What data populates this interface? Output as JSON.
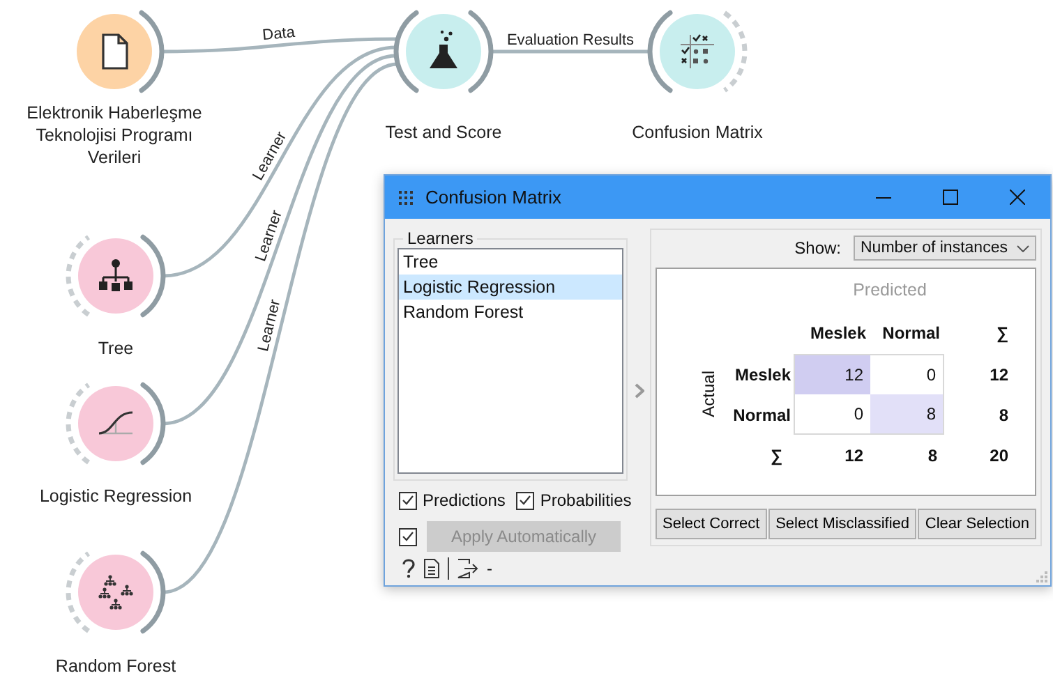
{
  "canvas": {
    "nodes": [
      {
        "kind": "file",
        "label": "Elektronik Haberleşme Teknolojisi Programı Verileri"
      },
      {
        "kind": "test",
        "label": "Test and Score"
      },
      {
        "kind": "confusion",
        "label": "Confusion Matrix"
      },
      {
        "kind": "tree",
        "label": "Tree"
      },
      {
        "kind": "logistic",
        "label": "Logistic Regression"
      },
      {
        "kind": "forest",
        "label": "Random Forest"
      }
    ],
    "links": [
      {
        "label": "Data"
      },
      {
        "label": "Learner"
      },
      {
        "label": "Learner"
      },
      {
        "label": "Learner"
      },
      {
        "label": "Evaluation Results"
      }
    ]
  },
  "window": {
    "title": "Confusion Matrix",
    "learners": {
      "title": "Learners",
      "items": [
        {
          "label": "Tree",
          "selected": false
        },
        {
          "label": "Logistic Regression",
          "selected": true
        },
        {
          "label": "Random Forest",
          "selected": false
        }
      ]
    },
    "options": [
      {
        "label": "Predictions",
        "checked": true
      },
      {
        "label": "Probabilities",
        "checked": true
      }
    ],
    "auto_apply": {
      "checked": true,
      "label": "Apply Automatically",
      "disabled": true
    },
    "show": {
      "label": "Show:",
      "value": "Number of instances"
    },
    "matrix": {
      "predicted_title": "Predicted",
      "actual_title": "Actual",
      "columns": [
        "Meslek",
        "Normal",
        "∑"
      ],
      "rows": [
        {
          "label": "Meslek",
          "cells": [
            {
              "value": "12",
              "color": "#d0cdf1"
            },
            {
              "value": "0",
              "color": "#ffffff"
            }
          ],
          "total": "12"
        },
        {
          "label": "Normal",
          "cells": [
            {
              "value": "0",
              "color": "#ffffff"
            },
            {
              "value": "8",
              "color": "#e2e0f8"
            }
          ],
          "total": "8"
        }
      ],
      "totals": {
        "label": "∑",
        "values": [
          "12",
          "8",
          "20"
        ]
      }
    },
    "buttons": [
      "Select Correct",
      "Select Misclassified",
      "Clear Selection"
    ],
    "status": {
      "output_summary": "-"
    }
  }
}
